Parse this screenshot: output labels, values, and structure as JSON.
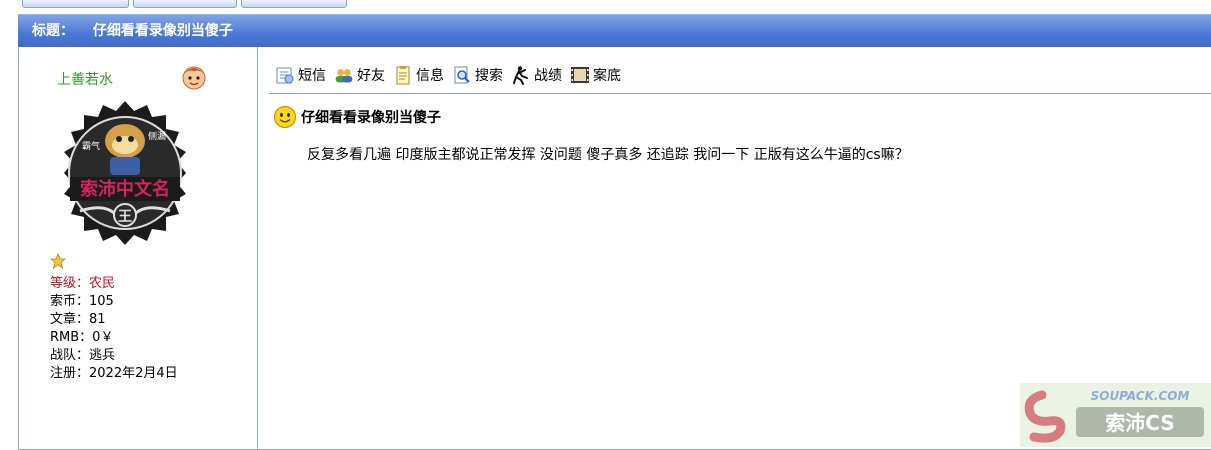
{
  "header": {
    "title_label": "标题：",
    "title_text": "仔细看看录像别当傻子"
  },
  "user": {
    "name": "上善若水",
    "avatar_text": "索沛中文名",
    "avatar_tags": [
      "霸气",
      "侧漏"
    ],
    "avatar_emblem": "王",
    "rank_label": "等级：",
    "rank_value": "农民",
    "coins_label": "索币：",
    "coins_value": "105",
    "articles_label": "文章：",
    "articles_value": "81",
    "rmb_label": "RMB：",
    "rmb_value": "0￥",
    "team_label": "战队：",
    "team_value": "逃兵",
    "register_label": "注册：",
    "register_value": "2022年2月4日"
  },
  "toolbar": {
    "items": [
      {
        "label": "短信",
        "icon": "message-icon"
      },
      {
        "label": "好友",
        "icon": "friends-icon"
      },
      {
        "label": "信息",
        "icon": "info-icon"
      },
      {
        "label": "搜索",
        "icon": "search-icon"
      },
      {
        "label": "战绩",
        "icon": "record-icon"
      },
      {
        "label": "案底",
        "icon": "film-icon"
      }
    ]
  },
  "post": {
    "title": "仔细看看录像别当傻子",
    "body": "反复多看几遍 印度版主都说正常发挥 没问题 傻子真多 还追踪 我问一下 正版有这么牛逼的cs嘛？"
  },
  "watermark": {
    "text_top": "SOUPACK.COM",
    "text_bottom": "索沛CS"
  },
  "colors": {
    "title_bar": "#4a77d2",
    "border": "#8ea9d6",
    "username": "#2e9a2e",
    "rank": "#c0141b"
  }
}
